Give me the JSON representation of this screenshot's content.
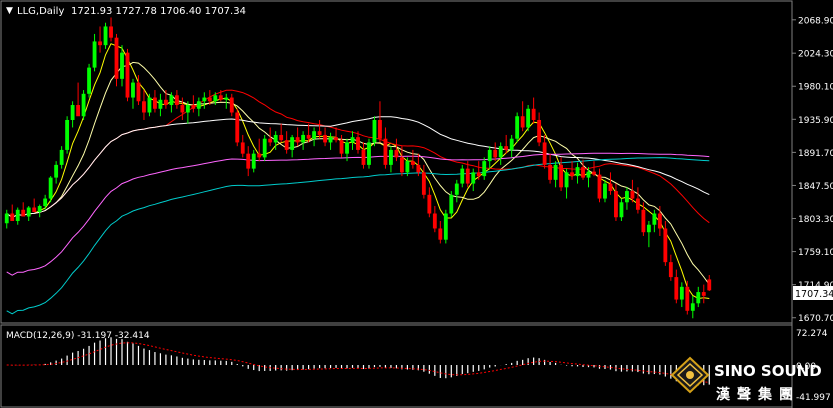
{
  "header": {
    "symbol_label": "LLG,Daily",
    "ohlc_label": "1721.93 1727.78 1706.40 1707.34"
  },
  "macd": {
    "label": "MACD(12,26,9) -31.197 -32.414",
    "ticks": [
      "72.274",
      "0.00",
      "-41.997"
    ]
  },
  "price_axis": {
    "ticks": [
      "2068.90",
      "2024.30",
      "1980.10",
      "1935.90",
      "1891.70",
      "1847.50",
      "1803.30",
      "1759.10",
      "1714.90",
      "1670.70"
    ],
    "current_price": "1707.34"
  },
  "logo": {
    "name_en": "SINO SOUND",
    "name_cn": "漢聲集團"
  },
  "colors": {
    "background": "#000000",
    "bull_candle": "#00ff00",
    "bear_candle": "#ff0000",
    "grid_text": "#ffffff",
    "ma_fast": "#ffff00",
    "ma_slow_1": "#ffffff",
    "ma_red": "#ff0000",
    "ma_pink": "#ff66ff",
    "ma_teal": "#00cccc",
    "macd_hist": "#ffffff",
    "macd_signal": "#ff0000"
  },
  "chart_data": {
    "type": "candlestick",
    "symbol": "LLG",
    "timeframe": "Daily",
    "ylim": [
      1665,
      2082
    ],
    "candles": [
      [
        1797,
        1815,
        1790,
        1810
      ],
      [
        1810,
        1822,
        1805,
        1800
      ],
      [
        1800,
        1818,
        1795,
        1815
      ],
      [
        1815,
        1825,
        1808,
        1806
      ],
      [
        1806,
        1820,
        1800,
        1818
      ],
      [
        1818,
        1830,
        1812,
        1812
      ],
      [
        1812,
        1822,
        1805,
        1820
      ],
      [
        1820,
        1835,
        1815,
        1830
      ],
      [
        1830,
        1860,
        1825,
        1858
      ],
      [
        1858,
        1880,
        1850,
        1875
      ],
      [
        1875,
        1900,
        1870,
        1895
      ],
      [
        1895,
        1940,
        1890,
        1935
      ],
      [
        1935,
        1960,
        1925,
        1955
      ],
      [
        1955,
        1985,
        1945,
        1940
      ],
      [
        1940,
        1975,
        1935,
        1970
      ],
      [
        1970,
        2010,
        1965,
        2005
      ],
      [
        2005,
        2050,
        2000,
        2040
      ],
      [
        2040,
        2060,
        2025,
        2035
      ],
      [
        2035,
        2065,
        2030,
        2060
      ],
      [
        2060,
        2072,
        2040,
        2045
      ],
      [
        2045,
        2050,
        1980,
        1990
      ],
      [
        1990,
        2035,
        1980,
        2025
      ],
      [
        2025,
        2030,
        1960,
        1965
      ],
      [
        1965,
        1990,
        1950,
        1985
      ],
      [
        1985,
        1995,
        1955,
        1960
      ],
      [
        1960,
        1975,
        1935,
        1945
      ],
      [
        1945,
        1970,
        1940,
        1965
      ],
      [
        1965,
        1975,
        1945,
        1950
      ],
      [
        1950,
        1970,
        1940,
        1962
      ],
      [
        1962,
        1975,
        1950,
        1955
      ],
      [
        1955,
        1972,
        1945,
        1968
      ],
      [
        1968,
        1975,
        1950,
        1955
      ],
      [
        1955,
        1965,
        1935,
        1945
      ],
      [
        1945,
        1960,
        1930,
        1955
      ],
      [
        1955,
        1968,
        1945,
        1950
      ],
      [
        1950,
        1965,
        1940,
        1960
      ],
      [
        1960,
        1972,
        1950,
        1965
      ],
      [
        1965,
        1975,
        1955,
        1960
      ],
      [
        1960,
        1972,
        1955,
        1968
      ],
      [
        1968,
        1975,
        1960,
        1962
      ],
      [
        1962,
        1970,
        1950,
        1965
      ],
      [
        1965,
        1970,
        1940,
        1945
      ],
      [
        1945,
        1950,
        1900,
        1905
      ],
      [
        1905,
        1915,
        1885,
        1890
      ],
      [
        1890,
        1900,
        1860,
        1870
      ],
      [
        1870,
        1895,
        1865,
        1890
      ],
      [
        1890,
        1910,
        1880,
        1885
      ],
      [
        1885,
        1915,
        1880,
        1910
      ],
      [
        1910,
        1925,
        1900,
        1905
      ],
      [
        1905,
        1920,
        1895,
        1915
      ],
      [
        1915,
        1930,
        1905,
        1908
      ],
      [
        1908,
        1920,
        1890,
        1895
      ],
      [
        1895,
        1915,
        1885,
        1912
      ],
      [
        1912,
        1925,
        1900,
        1905
      ],
      [
        1905,
        1920,
        1895,
        1915
      ],
      [
        1915,
        1930,
        1905,
        1910
      ],
      [
        1910,
        1925,
        1900,
        1920
      ],
      [
        1920,
        1935,
        1910,
        1915
      ],
      [
        1915,
        1925,
        1900,
        1905
      ],
      [
        1905,
        1918,
        1895,
        1912
      ],
      [
        1912,
        1925,
        1905,
        1908
      ],
      [
        1908,
        1915,
        1885,
        1890
      ],
      [
        1890,
        1910,
        1880,
        1905
      ],
      [
        1905,
        1920,
        1895,
        1912
      ],
      [
        1912,
        1920,
        1890,
        1895
      ],
      [
        1895,
        1905,
        1870,
        1875
      ],
      [
        1875,
        1910,
        1870,
        1905
      ],
      [
        1905,
        1940,
        1900,
        1935
      ],
      [
        1935,
        1960,
        1905,
        1910
      ],
      [
        1910,
        1925,
        1870,
        1875
      ],
      [
        1875,
        1900,
        1865,
        1895
      ],
      [
        1895,
        1910,
        1880,
        1885
      ],
      [
        1885,
        1900,
        1860,
        1865
      ],
      [
        1865,
        1885,
        1860,
        1880
      ],
      [
        1880,
        1895,
        1870,
        1875
      ],
      [
        1875,
        1890,
        1860,
        1865
      ],
      [
        1865,
        1875,
        1830,
        1835
      ],
      [
        1835,
        1845,
        1805,
        1810
      ],
      [
        1810,
        1820,
        1785,
        1790
      ],
      [
        1790,
        1800,
        1770,
        1775
      ],
      [
        1775,
        1815,
        1770,
        1810
      ],
      [
        1810,
        1840,
        1805,
        1835
      ],
      [
        1835,
        1855,
        1825,
        1850
      ],
      [
        1850,
        1875,
        1845,
        1870
      ],
      [
        1870,
        1880,
        1845,
        1850
      ],
      [
        1850,
        1870,
        1840,
        1865
      ],
      [
        1865,
        1880,
        1855,
        1860
      ],
      [
        1860,
        1885,
        1855,
        1880
      ],
      [
        1880,
        1900,
        1870,
        1895
      ],
      [
        1895,
        1905,
        1880,
        1885
      ],
      [
        1885,
        1905,
        1875,
        1900
      ],
      [
        1900,
        1915,
        1890,
        1895
      ],
      [
        1895,
        1915,
        1885,
        1910
      ],
      [
        1910,
        1945,
        1905,
        1940
      ],
      [
        1940,
        1960,
        1920,
        1925
      ],
      [
        1925,
        1955,
        1920,
        1950
      ],
      [
        1950,
        1965,
        1930,
        1935
      ],
      [
        1935,
        1945,
        1900,
        1905
      ],
      [
        1905,
        1915,
        1870,
        1875
      ],
      [
        1875,
        1890,
        1850,
        1855
      ],
      [
        1855,
        1880,
        1845,
        1875
      ],
      [
        1875,
        1885,
        1840,
        1845
      ],
      [
        1845,
        1870,
        1830,
        1865
      ],
      [
        1865,
        1880,
        1855,
        1860
      ],
      [
        1860,
        1878,
        1850,
        1872
      ],
      [
        1872,
        1882,
        1855,
        1858
      ],
      [
        1858,
        1872,
        1845,
        1866
      ],
      [
        1866,
        1880,
        1860,
        1862
      ],
      [
        1862,
        1870,
        1825,
        1830
      ],
      [
        1830,
        1855,
        1825,
        1850
      ],
      [
        1850,
        1865,
        1835,
        1840
      ],
      [
        1840,
        1850,
        1800,
        1805
      ],
      [
        1805,
        1830,
        1800,
        1825
      ],
      [
        1825,
        1845,
        1815,
        1840
      ],
      [
        1840,
        1855,
        1825,
        1830
      ],
      [
        1830,
        1845,
        1810,
        1815
      ],
      [
        1815,
        1825,
        1780,
        1785
      ],
      [
        1785,
        1800,
        1765,
        1795
      ],
      [
        1795,
        1815,
        1785,
        1810
      ],
      [
        1810,
        1820,
        1780,
        1790
      ],
      [
        1790,
        1800,
        1740,
        1745
      ],
      [
        1745,
        1755,
        1720,
        1725
      ],
      [
        1725,
        1735,
        1690,
        1695
      ],
      [
        1695,
        1718,
        1685,
        1712
      ],
      [
        1712,
        1720,
        1675,
        1680
      ],
      [
        1680,
        1700,
        1670,
        1690
      ],
      [
        1690,
        1712,
        1685,
        1705
      ],
      [
        1705,
        1715,
        1690,
        1700
      ],
      [
        1721.93,
        1727.78,
        1706.4,
        1707.34
      ]
    ]
  }
}
